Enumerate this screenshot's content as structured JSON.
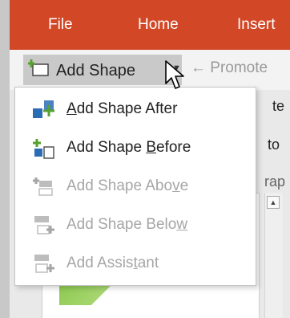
{
  "ribbon": {
    "tabs": [
      {
        "label": "File"
      },
      {
        "label": "Home"
      },
      {
        "label": "Insert"
      }
    ]
  },
  "toolbar": {
    "add_shape_label": "Add Shape",
    "promote_label": "Promote",
    "promote_icon": "left-arrow-icon"
  },
  "background": {
    "text_1": "te",
    "text_2": "to",
    "text_3": "rap"
  },
  "menu": {
    "items": [
      {
        "label": "Add Shape After",
        "underline": "A",
        "enabled": true,
        "icon": "add-shape-after-icon"
      },
      {
        "label": "Add Shape Before",
        "underline": "B",
        "enabled": true,
        "icon": "add-shape-before-icon"
      },
      {
        "label": "Add Shape Above",
        "underline": "v",
        "enabled": false,
        "icon": "add-shape-above-icon"
      },
      {
        "label": "Add Shape Below",
        "underline": "w",
        "enabled": false,
        "icon": "add-shape-below-icon"
      },
      {
        "label": "Add Assistant",
        "underline": "t",
        "enabled": false,
        "icon": "add-assistant-icon"
      }
    ]
  },
  "colors": {
    "ribbon": "#d24726",
    "icon_blue": "#2b6cb5",
    "icon_green": "#57a12f",
    "disabled": "#a6a6a6"
  }
}
